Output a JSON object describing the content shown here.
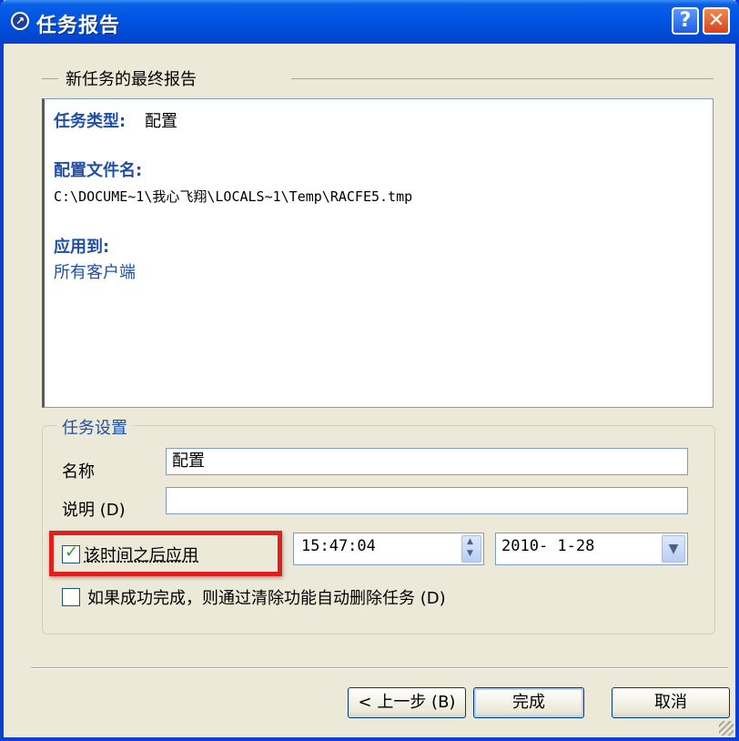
{
  "window": {
    "title": "任务报告",
    "help_label": "?",
    "close_label": "✕",
    "icon": "app-icon"
  },
  "report_section": {
    "title": "新任务的最终报告",
    "task_type_label": "任务类型:",
    "task_type_value": "配置",
    "config_file_label": "配置文件名:",
    "config_file_value": "C:\\DOCUME~1\\我心飞翔\\LOCALS~1\\Temp\\RACFE5.tmp",
    "apply_to_label": "应用到:",
    "apply_to_value": "所有客户端"
  },
  "settings": {
    "title": "任务设置",
    "name_label": "名称",
    "name_value": "配置",
    "desc_label": "说明 (D)",
    "desc_value": "",
    "apply_after_label": "该时间之后应用",
    "apply_after_checked": true,
    "time_value": "15:47:04",
    "date_value": "2010- 1-28",
    "auto_delete_label": "如果成功完成，则通过清除功能自动删除任务 (D)",
    "auto_delete_checked": false
  },
  "buttons": {
    "back": "< 上一步 (B)",
    "finish": "完成",
    "cancel": "取消"
  },
  "colors": {
    "accent_blue": "#1f4fa8",
    "highlight_red": "#e0201c",
    "titlebar": "#0054e3"
  }
}
